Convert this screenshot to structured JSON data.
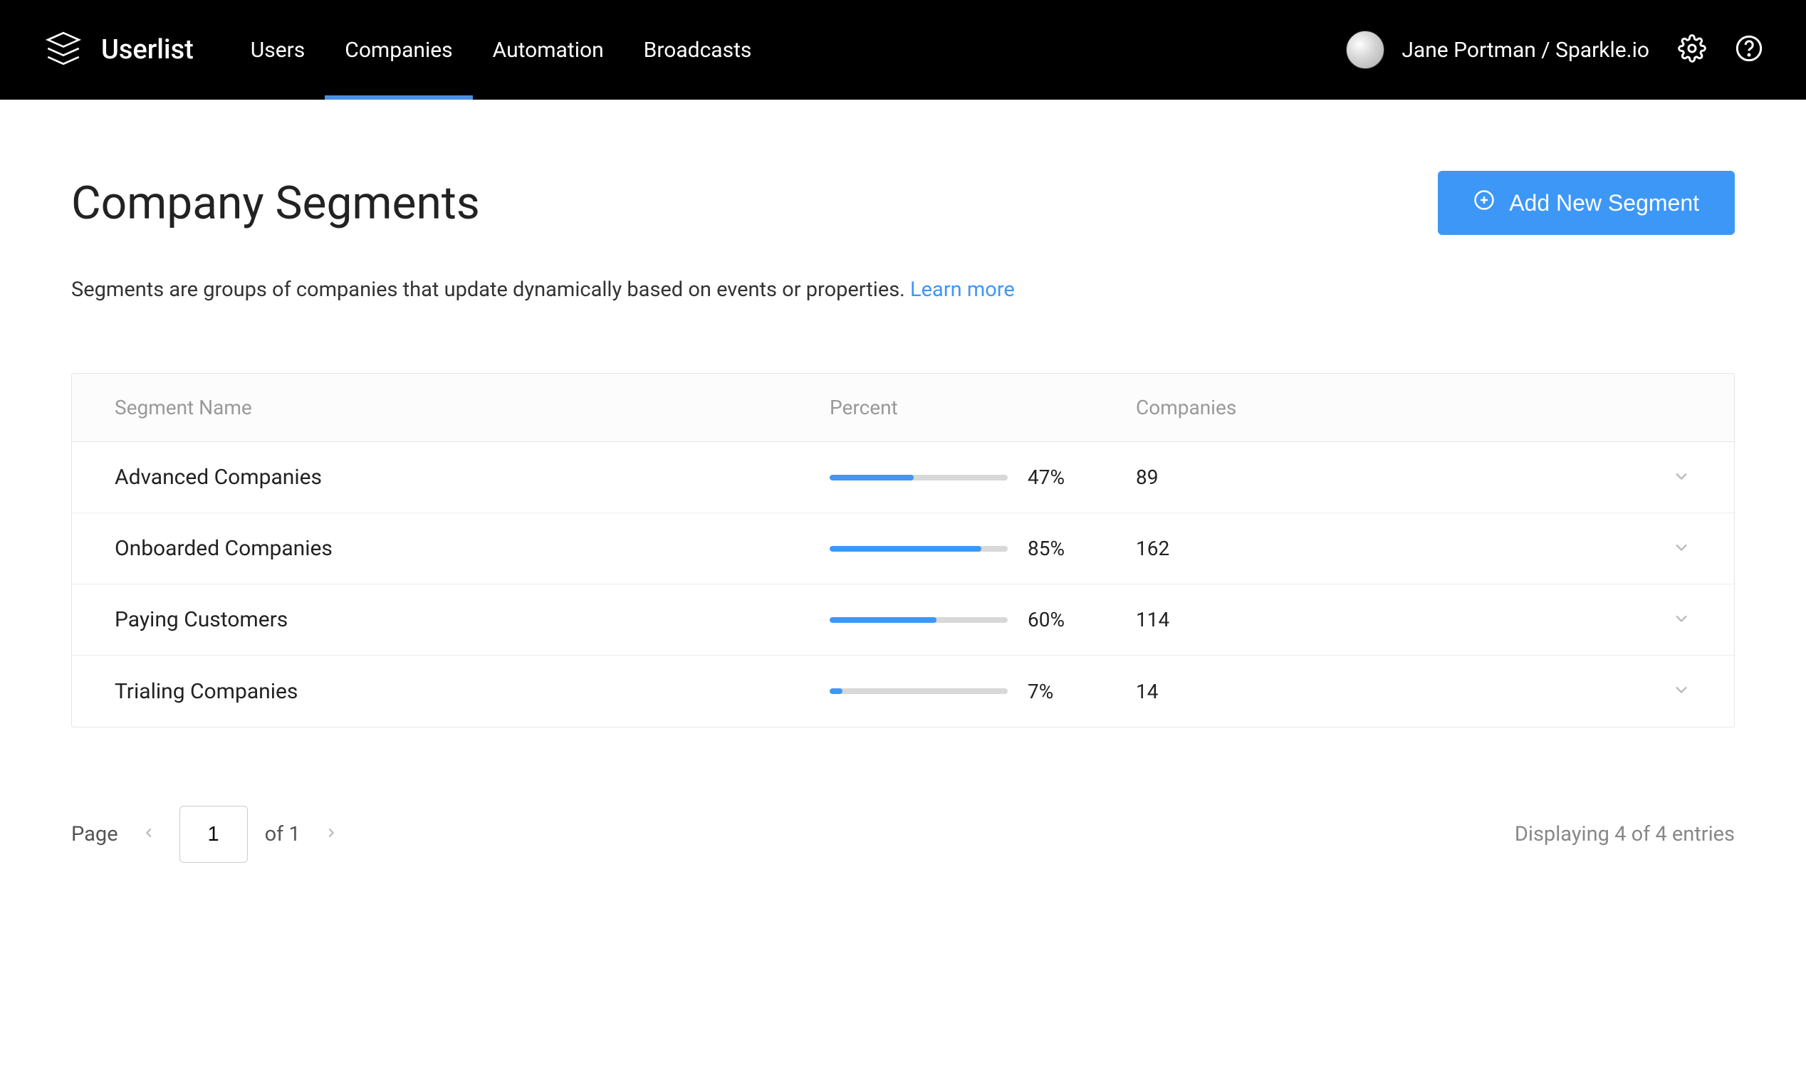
{
  "brand": {
    "name": "Userlist"
  },
  "nav": {
    "items": [
      {
        "label": "Users",
        "active": false
      },
      {
        "label": "Companies",
        "active": true
      },
      {
        "label": "Automation",
        "active": false
      },
      {
        "label": "Broadcasts",
        "active": false
      }
    ]
  },
  "user": {
    "display": "Jane Portman / Sparkle.io"
  },
  "page": {
    "title": "Company Segments",
    "add_button": "Add New Segment",
    "description_text": "Segments are groups of companies that update dynamically based on events or properties.",
    "learn_more": "Learn more"
  },
  "table": {
    "columns": {
      "name": "Segment Name",
      "percent": "Percent",
      "companies": "Companies"
    },
    "rows": [
      {
        "name": "Advanced Companies",
        "percent": 47,
        "percent_label": "47%",
        "companies": "89"
      },
      {
        "name": "Onboarded Companies",
        "percent": 85,
        "percent_label": "85%",
        "companies": "162"
      },
      {
        "name": "Paying Customers",
        "percent": 60,
        "percent_label": "60%",
        "companies": "114"
      },
      {
        "name": "Trialing Companies",
        "percent": 7,
        "percent_label": "7%",
        "companies": "14"
      }
    ]
  },
  "pagination": {
    "page_label": "Page",
    "current": "1",
    "of_label": "of 1",
    "displaying": "Displaying 4 of 4 entries"
  },
  "colors": {
    "accent": "#3d97f7"
  }
}
